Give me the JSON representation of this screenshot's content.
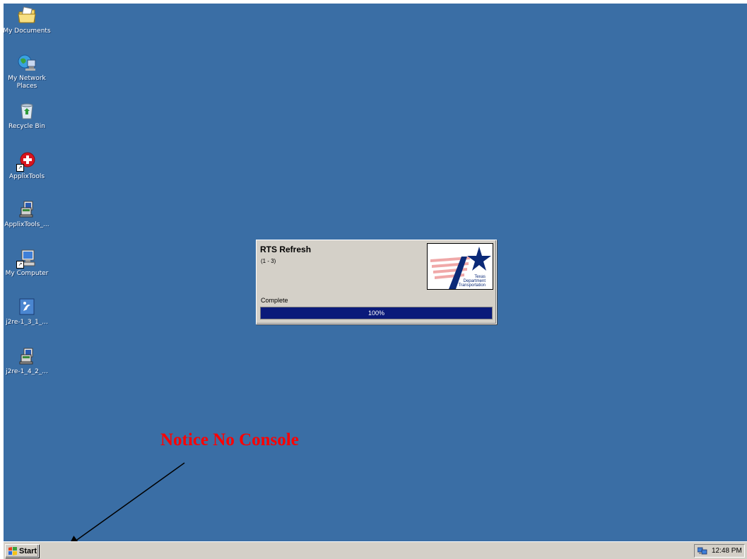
{
  "desktop": {
    "icons": [
      {
        "label": "My Documents",
        "icon": "folder-documents-icon"
      },
      {
        "label": "My Network\nPlaces",
        "icon": "network-places-icon"
      },
      {
        "label": "Recycle Bin",
        "icon": "recycle-bin-icon"
      },
      {
        "label": "ApplixTools",
        "icon": "applix-tools-icon"
      },
      {
        "label": "ApplixTools_...",
        "icon": "installer-icon"
      },
      {
        "label": "My Computer",
        "icon": "my-computer-icon"
      },
      {
        "label": "j2re-1_3_1_...",
        "icon": "java-installer-icon"
      },
      {
        "label": "j2re-1_4_2_...",
        "icon": "installer-icon"
      }
    ]
  },
  "dialog": {
    "title": "RTS Refresh",
    "subtitle": "(1 - 3)",
    "logo_text": "Texas\nDepartment\nof Transportation",
    "status": "Complete",
    "progress_percent": 100,
    "progress_label": "100%"
  },
  "annotation": {
    "text": "Notice No Console",
    "color": "#ff0000"
  },
  "taskbar": {
    "start_label": "Start",
    "clock": "12:48 PM"
  },
  "colors": {
    "desktop": "#3a6ea5",
    "taskbar": "#d4d0c8",
    "progress": "#0a1a7a"
  }
}
